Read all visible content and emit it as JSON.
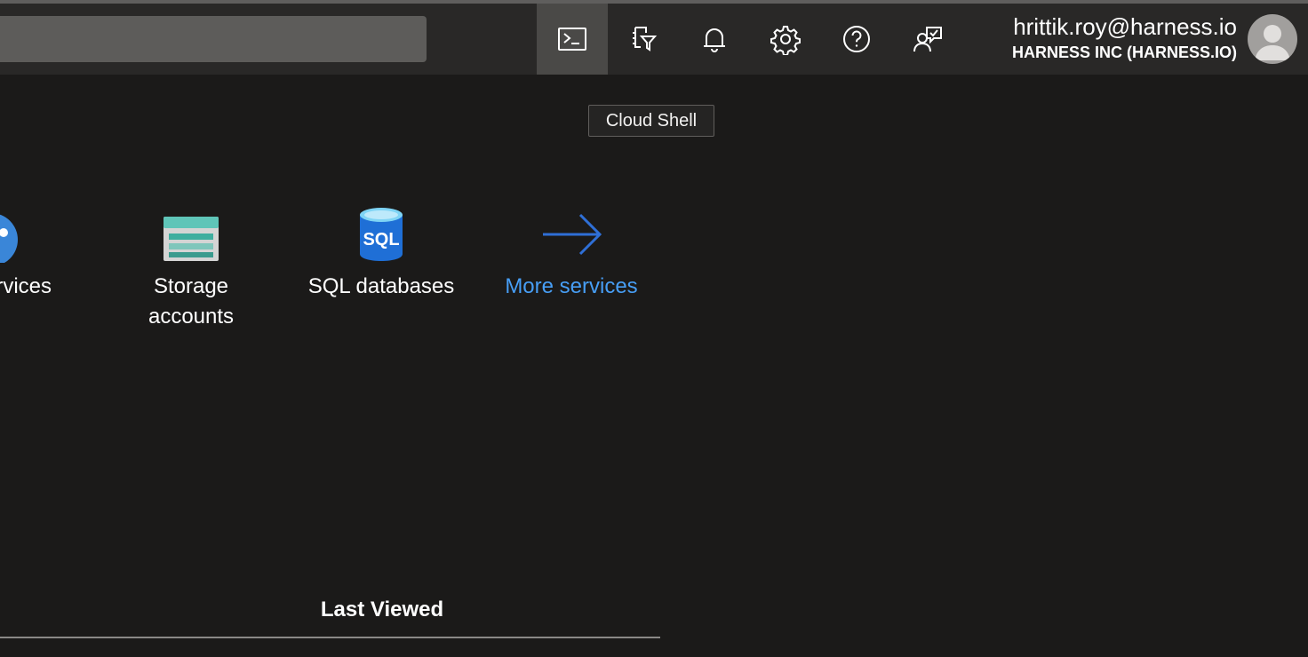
{
  "header": {
    "search": {
      "placeholder": ""
    },
    "icons": [
      {
        "name": "cloud-shell",
        "label": "Cloud Shell",
        "active": true
      },
      {
        "name": "directory-filter",
        "label": "Directory + subscription filter"
      },
      {
        "name": "notifications",
        "label": "Notifications"
      },
      {
        "name": "settings",
        "label": "Settings"
      },
      {
        "name": "help",
        "label": "Help"
      },
      {
        "name": "feedback",
        "label": "Feedback"
      }
    ],
    "account": {
      "email": "hrittik.roy@harness.io",
      "organization": "HARNESS INC (HARNESS.IO)"
    }
  },
  "tooltip": {
    "text": "Cloud Shell"
  },
  "services": [
    {
      "label_line1": "ervices",
      "label_line2": "",
      "icon": "app-services-icon"
    },
    {
      "label_line1": "Storage",
      "label_line2": "accounts",
      "icon": "storage-accounts-icon"
    },
    {
      "label_line1": "SQL databases",
      "label_line2": "",
      "icon": "sql-database-icon"
    },
    {
      "label_line1": "More services",
      "label_line2": "",
      "icon": "arrow-right-icon"
    }
  ],
  "sql_icon_text": "SQL",
  "section": {
    "last_viewed": "Last Viewed"
  },
  "colors": {
    "background": "#1b1a19",
    "header": "#292827",
    "accent": "#479ef5",
    "arrow": "#2f6fd6"
  }
}
